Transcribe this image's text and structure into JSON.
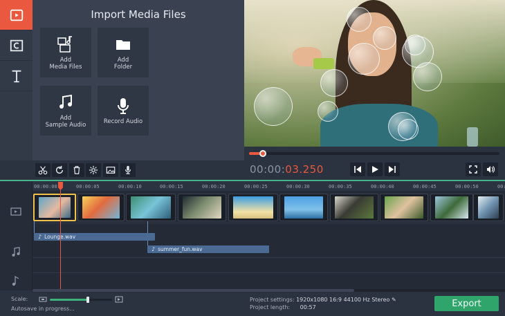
{
  "sidebar": {
    "items": [
      {
        "name": "media-import",
        "icon": "filmstrip-icon",
        "active": true
      },
      {
        "name": "filters",
        "icon": "film-frame-icon",
        "active": false
      },
      {
        "name": "titles",
        "icon": "text-icon",
        "active": false
      }
    ]
  },
  "import_panel": {
    "title": "Import Media Files",
    "tiles": [
      {
        "label": "Add\nMedia Files",
        "icon": "media-files-icon"
      },
      {
        "label": "Add\nFolder",
        "icon": "folder-icon"
      },
      {
        "label": "Add\nSample Audio",
        "icon": "music-note-icon"
      },
      {
        "label": "Record Audio",
        "icon": "microphone-icon"
      }
    ]
  },
  "player": {
    "timecode_dim": "00:00:",
    "timecode_active": "03.250",
    "progress": 0.05
  },
  "timeline": {
    "ticks": [
      "00:00:00",
      "00:00:05",
      "00:00:10",
      "00:00:15",
      "00:00:20",
      "00:00:25",
      "00:00:30",
      "00:00:35",
      "00:00:40",
      "00:00:45",
      "00:00:50",
      "00:00:"
    ],
    "audio_clips": [
      {
        "name": "Lounge.wav"
      },
      {
        "name": "summer_fun.wav"
      }
    ]
  },
  "footer": {
    "scale_label": "Scale:",
    "autosave": "Autosave in progress...",
    "settings_label": "Project settings:",
    "settings_value": "1920x1080 16:9 44100 Hz Stereo",
    "length_label": "Project length:",
    "length_value": "00:57",
    "export_label": "Export"
  },
  "colors": {
    "accent": "#e9583f",
    "export": "#2fa56c",
    "timeline_divider": "#49b48a",
    "audio_clip": "#4b6a93"
  }
}
